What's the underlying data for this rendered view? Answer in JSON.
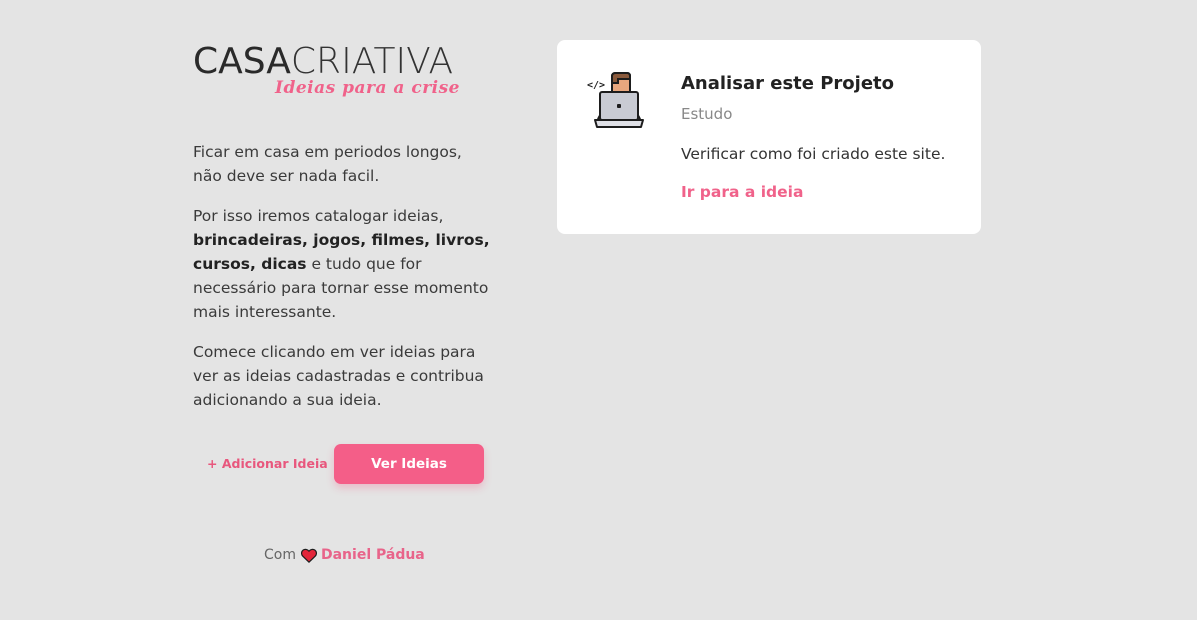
{
  "brand": {
    "name_part1": "CASA",
    "name_part2": "CRIATIVA",
    "tagline": "Ideias para a crise"
  },
  "intro": {
    "p1": "Ficar em casa em periodos longos, não deve ser nada facil.",
    "p2_start": "Por isso iremos catalogar ideias, ",
    "p2_bold": "brincadeiras, jogos, filmes, livros, cursos, dicas",
    "p2_end": " e tudo que for necessário para tornar esse momento mais interessante.",
    "p3": "Comece clicando em ver ideias para ver as ideias cadastradas e contribua adicionando a sua ideia."
  },
  "actions": {
    "add_label": "+ Adicionar Ideia",
    "view_label": "Ver Ideias"
  },
  "footer": {
    "prefix": "Com",
    "author": "Daniel Pádua"
  },
  "idea_card": {
    "title": "Analisar este Projeto",
    "category": "Estudo",
    "description": "Verificar como foi criado este site.",
    "link_label": "Ir para a ideia",
    "icon": "programmer-laptop-icon"
  },
  "colors": {
    "accent": "#f45e88",
    "background": "#e4e4e4",
    "card": "#ffffff"
  }
}
